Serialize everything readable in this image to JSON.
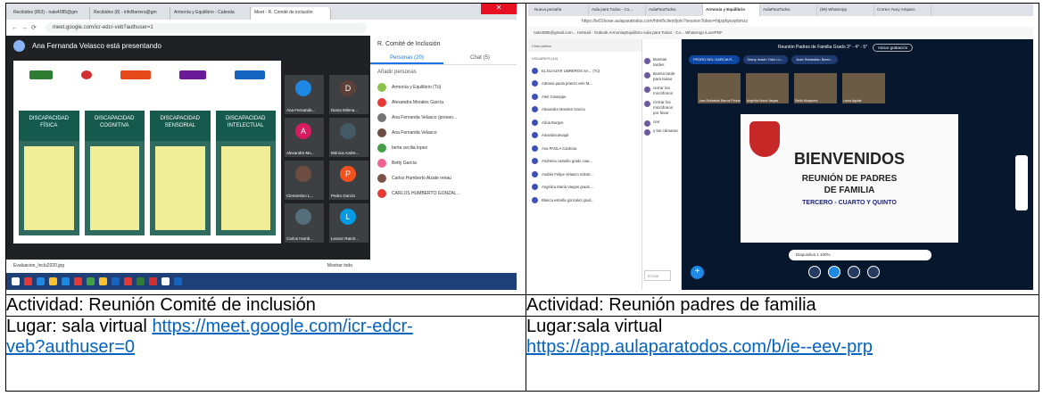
{
  "cells": {
    "left": {
      "activity": "Actividad: Reunión Comité de inclusión",
      "place_label": "Lugar: sala virtual",
      "place_link_line1": "https://meet.google.com/icr-edcr-",
      "place_link_line2": "veb?authuser=0"
    },
    "right": {
      "activity": "Actividad: Reunión padres de familia",
      "place_label": "Lugar:sala virtual",
      "place_link": "https://app.aulaparatodos.com/b/ie--eev-prp"
    }
  },
  "meet": {
    "tabs": [
      "Recibidos (853) - nats4085@gm",
      "Recibidos (8) - infoBarrera@gm",
      "Armonía y Equilibrio - Calenda",
      "Meet - R. Comité de inclusión"
    ],
    "url": "meet.google.com/icr-edcr-veb?authuser=1",
    "presenter_text": "Ana Fernanda Velasco está presentando",
    "slide_headers": [
      "DISCAPACIDAD FÍSICA",
      "DISCAPACIDAD COGNITIVA",
      "DISCAPACIDAD SENSORIAL",
      "DISCAPACIDAD INTELECTUAL"
    ],
    "participants_grid": [
      {
        "initial": "",
        "name": "Ana Fernanda..."
      },
      {
        "initial": "D",
        "name": "Diana Milena..."
      },
      {
        "initial": "A",
        "name": "Alexandre Mo..."
      },
      {
        "initial": "",
        "name": "Mónica Andre..."
      },
      {
        "initial": "",
        "name": "Clementino L..."
      },
      {
        "initial": "P",
        "name": "Pedro García"
      },
      {
        "initial": "",
        "name": "Carlos Humb..."
      },
      {
        "initial": "L",
        "name": "Leonor Ramír..."
      }
    ],
    "panel_title": "R. Comité de Inclusión",
    "panel_tab_people": "Personas (20)",
    "panel_tab_chat": "Chat (5)",
    "panel_add": "Añadir personas",
    "panel_people": [
      "Armonía y Equilibrio (Tú)",
      "Alexandra Morales García",
      "Ana Fernanda Velasco (presen...",
      "Ana Fernanda Velasco",
      "berta cecilia lopez",
      "Betty García",
      "Carlos Humberto Alzate renau",
      "CARLOS HUMBERTO GONZAL..."
    ],
    "file_name": "Evaluacion_Inclu2020.jpg",
    "show_all": "Mostrar todo"
  },
  "aula": {
    "tabs": [
      "Nueva pestaña",
      "Aula para Todos - Co...",
      "AulaParaTodos",
      "Armonía y Equilibrio",
      "AulaParaTodos",
      "(59) WhatsApp",
      "Correo: Nury Amparo"
    ],
    "url": "https://ie01hoae.aulaparatodos.com/html5client/join?sessionToken=htjzpfqsvqrbmzz",
    "bookmarks": "nats4085@gmail.com...   Hotmail - Outlook   ArmoniayEquilibrio   Aula para Todos - Co...   WhatsApp   iLovePDF",
    "sidebar_header": "USUARIOS (14)",
    "chat_label": "Chat público",
    "users": [
      "EL ELIAZAR LIBREROS SA... (Tú)",
      "Adriana paola pranzo vele M...",
      "Aleir Giuseppe",
      "Alexandra Morales García",
      "Alicia Burgos",
      "Amandacarvajal",
      "Ana PAOLA Cardona",
      "Andreina castaño grado cuar...",
      "Andrés Felipe Velasco Arbole...",
      "Angélica María Vargas grado ...",
      "Blanca estrella gonzalez grad..."
    ],
    "chat_messages": [
      "Buenas tardes",
      "Buena tarde para todos",
      "cerrar los micrófonos",
      "Cerrar los micrófonos por favor",
      "cerr",
      "y las cámaras"
    ],
    "chat_input": "Enviar",
    "meeting_title": "Reunión Padres de Familia Grado 3° - 4° - 5°",
    "record": "Iniciar grabación",
    "chips": [
      "PEDRO NEL GARCIA R...",
      "Diany mavin Tulio Lu...",
      "Juan Sebastian Barro..."
    ],
    "cams": [
      "Juan Sebastian Barros Pinzon",
      "Angelica María Vargas",
      "Stella Mosquera",
      "Laura Aguilar"
    ],
    "slide_title": "BIENVENIDOS",
    "slide_sub1": "REUNIÓN DE PADRES",
    "slide_sub2": "DE FAMILIA",
    "slide_sub3": "TERCERO - CUARTO Y QUINTO",
    "pager": "Diapositiva 1    100%"
  }
}
